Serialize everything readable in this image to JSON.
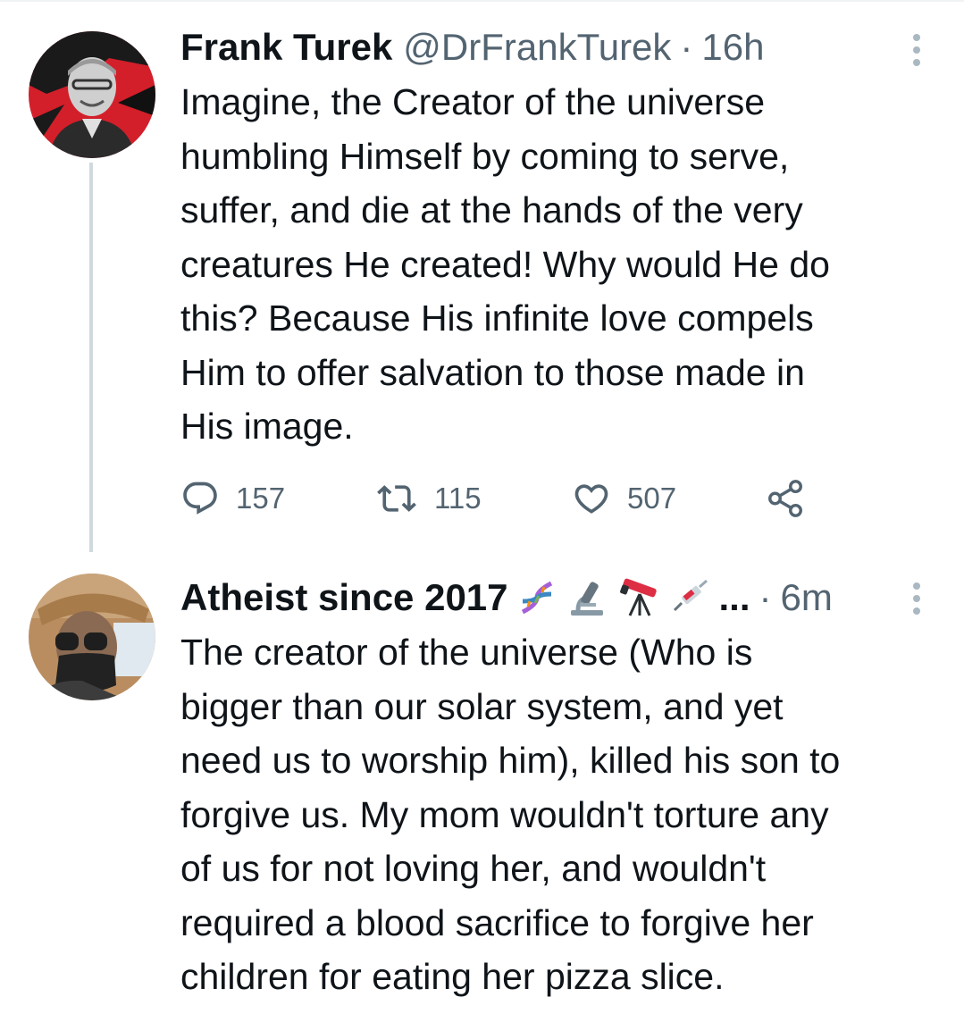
{
  "tweets": [
    {
      "author": {
        "display_name": "Frank Turek",
        "handle": "@DrFrankTurek",
        "avatar": "man-portrait-red-background"
      },
      "separator": "·",
      "time": "16h",
      "text": "Imagine, the Creator of the universe\nhumbling Himself by coming to serve,\nsuffer, and die at the hands of the very\ncreatures He created! Why would He do\nthis? Because His infinite love compels\nHim to offer salvation to those made in\nHis image.",
      "actions": {
        "replies": "157",
        "retweets": "115",
        "likes": "507"
      }
    },
    {
      "author": {
        "display_name": "Atheist since 2017",
        "name_emojis": [
          "dna-emoji",
          "microscope-emoji",
          "telescope-emoji",
          "syringe-emoji"
        ],
        "truncation": "...",
        "avatar": "person-sunglasses-mask-hat"
      },
      "separator": "·",
      "time": "6m",
      "text": "The creator of the universe (Who is\nbigger than our solar system, and yet\nneed us to worship him), killed his son to\nforgive us. My mom wouldn't torture any\nof us for not loving her, and wouldn't\nrequired a blood sacrifice to forgive her\nchildren for eating her pizza slice."
    }
  ],
  "colors": {
    "text_primary": "#0f1419",
    "text_secondary": "#536471",
    "thread_line": "#cfd9de"
  },
  "icons": [
    "reply-icon",
    "retweet-icon",
    "like-icon",
    "share-icon",
    "more-options-icon"
  ]
}
